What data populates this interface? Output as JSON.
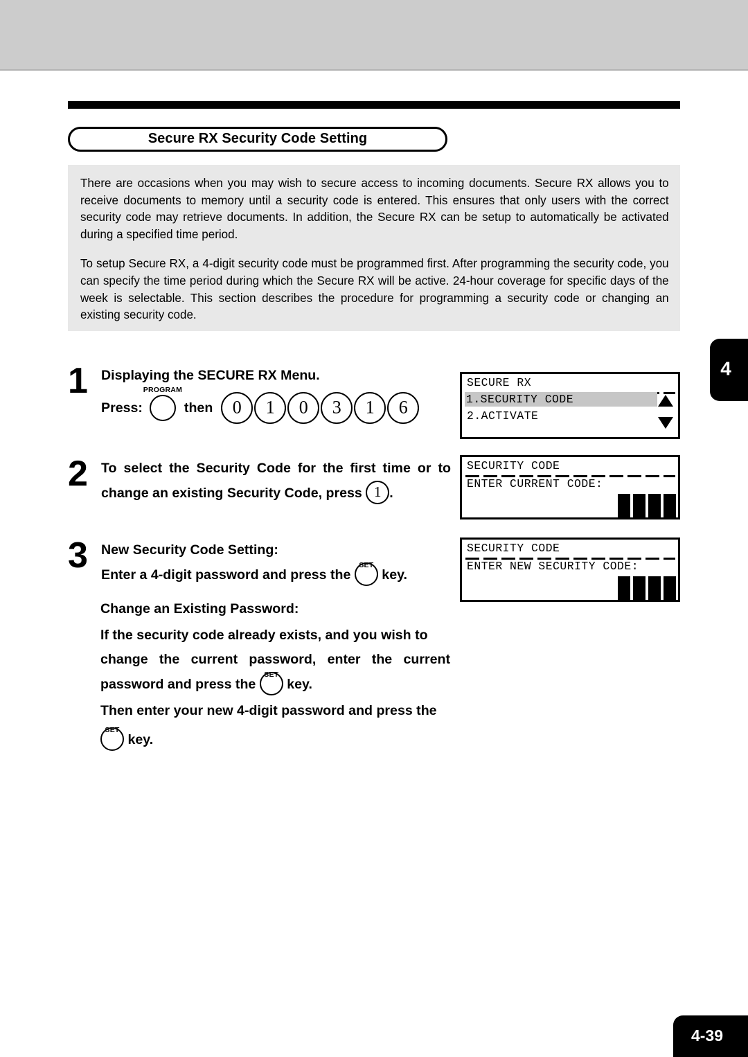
{
  "section": {
    "title": "Secure RX Security Code Setting"
  },
  "intro": {
    "paragraph1": "There are occasions when you may wish to secure access to incoming documents.  Secure RX allows you to receive documents to memory until a security code is entered.  This ensures that only users with the correct security code may retrieve documents.  In addition, the Secure RX can be setup to automatically be activated during a specified time period.",
    "paragraph2": "To setup Secure RX, a 4-digit security code must be programmed first.  After programming the security code, you can specify the time period during which the Secure RX will be active.  24-hour coverage for specific days of the week is selectable.  This section describes the procedure for programming a security code or changing an existing security code."
  },
  "chapter_tab": {
    "number": "4"
  },
  "steps": [
    {
      "number": "1",
      "heading": "Displaying the SECURE RX Menu.",
      "press_label": "Press:",
      "program_key_caption": "PROGRAM",
      "then_label": "then",
      "digits": [
        "0",
        "1",
        "0",
        "3",
        "1",
        "6"
      ]
    },
    {
      "number": "2",
      "line1": "To select the Security Code for the first time or to",
      "line2_prefix": "change an existing Security Code, press",
      "key": "1",
      "line2_suffix": "."
    },
    {
      "number": "3",
      "line1": "New Security Code Setting:",
      "line2_prefix": "Enter a 4-digit password and press the",
      "set_key_caption": "SET",
      "line2_suffix": "key."
    }
  ],
  "note": {
    "heading": "Change an Existing Password:",
    "line1": "If the security code already exists, and you wish to",
    "line2": "change the current password, enter the current",
    "line3_prefix": "password and press the",
    "line3_suffix": "key.",
    "line4": "Then enter your new 4-digit password and press the",
    "line5_suffix": "key.",
    "set_key_caption": "SET"
  },
  "lcd_panels": [
    {
      "title": "SECURE RX",
      "rows": [
        {
          "text": "1.SECURITY CODE",
          "highlighted": true
        },
        {
          "text": "2.ACTIVATE",
          "highlighted": false
        }
      ],
      "arrow_up": "scroll-up-arrow",
      "arrow_down": "scroll-down-arrow"
    },
    {
      "title": "SECURITY CODE",
      "prompt": "ENTER CURRENT CODE:",
      "code_blocks": 4
    },
    {
      "title": "SECURITY CODE",
      "prompt": "ENTER NEW SECURITY CODE:",
      "code_blocks": 4
    }
  ],
  "footer": {
    "page_number": "4-39"
  },
  "colors": {
    "band_gray": "#cccccc",
    "intro_gray": "#e8e8e8",
    "highlight_gray": "#c6c6c6",
    "ink": "#000000",
    "paper": "#ffffff"
  }
}
